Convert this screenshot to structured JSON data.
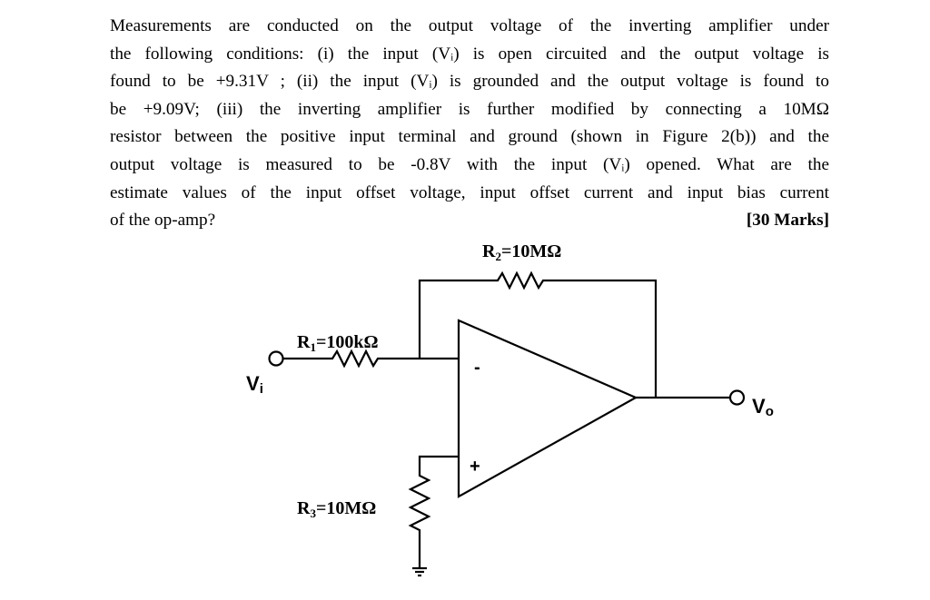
{
  "question": {
    "lines": [
      "Measurements are conducted on the output voltage of the inverting amplifier under",
      "the following conditions: (i) the input (Vᵢ) is open circuited and the output voltage is",
      "found to be +9.31V ; (ii) the input (Vᵢ) is grounded and the output voltage is found to",
      "be +9.09V; (iii) the inverting amplifier is further modified by connecting a 10MΩ",
      "resistor between the positive input terminal and ground (shown in Figure 2(b)) and the",
      "output voltage is measured to be -0.8V with the input (Vᵢ) opened.  What are the",
      "estimate values of the input offset voltage, input offset current and input bias current"
    ],
    "last_line": "of the op-amp?",
    "marks": "[30 Marks]"
  },
  "circuit": {
    "r1_label": {
      "name": "R",
      "sub": "1",
      "value": "=100kΩ"
    },
    "r2_label": {
      "name": "R",
      "sub": "2",
      "value": "=10MΩ"
    },
    "r3_label": {
      "name": "R",
      "sub": "3",
      "value": "=10MΩ"
    },
    "vin_label": {
      "name": "V",
      "sub": "i"
    },
    "vout_label": {
      "name": "V",
      "sub": "o"
    },
    "inverting_sign": "-",
    "noninverting_sign": "+"
  }
}
